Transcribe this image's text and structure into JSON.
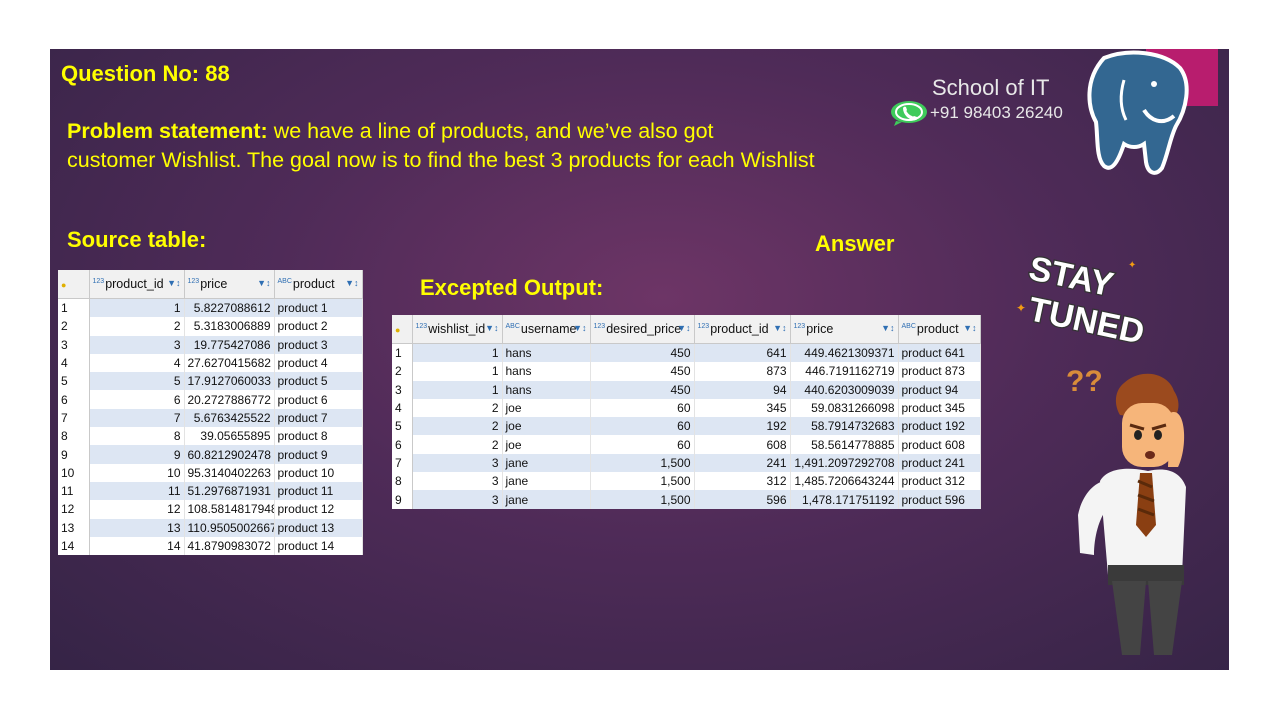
{
  "question": "Question No: 88",
  "problem": {
    "label": "Problem statement:",
    "line1": " we have a line of products, and we’ve also got",
    "line2": "customer Wishlist. The goal now is to find the best 3 products for each Wishlist"
  },
  "source_title": "Source table:",
  "answer_title": "Answer",
  "output_title": "Excepted Output:",
  "brand": {
    "name": "School of IT",
    "phone": "+91 98403 26240"
  },
  "colors": {
    "slide_bg": "#4f2b58",
    "heading": "#ffff00",
    "accent_bar": "#b81d6e",
    "row_alt": "#dde6f3"
  },
  "icons": [
    "whatsapp-icon",
    "postgresql-elephant-logo",
    "stay-tuned-sticker",
    "confused-man-illustration"
  ],
  "sticker_text": [
    "STAY",
    "TUNED"
  ],
  "sticker_marks": "??",
  "source_table": {
    "columns": [
      {
        "type": "123",
        "name": "product_id"
      },
      {
        "type": "123",
        "name": "price"
      },
      {
        "type": "ABC",
        "name": "product"
      }
    ],
    "rows": [
      [
        "1",
        "1",
        "5.8227088612",
        "product 1"
      ],
      [
        "2",
        "2",
        "5.3183006889",
        "product 2"
      ],
      [
        "3",
        "3",
        "19.775427086",
        "product 3"
      ],
      [
        "4",
        "4",
        "27.6270415682",
        "product 4"
      ],
      [
        "5",
        "5",
        "17.9127060033",
        "product 5"
      ],
      [
        "6",
        "6",
        "20.2727886772",
        "product 6"
      ],
      [
        "7",
        "7",
        "5.6763425522",
        "product 7"
      ],
      [
        "8",
        "8",
        "39.05655895",
        "product 8"
      ],
      [
        "9",
        "9",
        "60.8212902478",
        "product 9"
      ],
      [
        "10",
        "10",
        "95.3140402263",
        "product 10"
      ],
      [
        "11",
        "11",
        "51.2976871931",
        "product 11"
      ],
      [
        "12",
        "12",
        "108.5814817948",
        "product 12"
      ],
      [
        "13",
        "13",
        "110.9505002667",
        "product 13"
      ],
      [
        "14",
        "14",
        "41.8790983072",
        "product 14"
      ]
    ]
  },
  "output_table": {
    "columns": [
      {
        "type": "123",
        "name": "wishlist_id"
      },
      {
        "type": "ABC",
        "name": "username"
      },
      {
        "type": "123",
        "name": "desired_price"
      },
      {
        "type": "123",
        "name": "product_id"
      },
      {
        "type": "123",
        "name": "price"
      },
      {
        "type": "ABC",
        "name": "product"
      }
    ],
    "rows": [
      [
        "1",
        "1",
        "hans",
        "450",
        "641",
        "449.4621309371",
        "product 641"
      ],
      [
        "2",
        "1",
        "hans",
        "450",
        "873",
        "446.7191162719",
        "product 873"
      ],
      [
        "3",
        "1",
        "hans",
        "450",
        "94",
        "440.6203009039",
        "product 94"
      ],
      [
        "4",
        "2",
        "joe",
        "60",
        "345",
        "59.0831266098",
        "product 345"
      ],
      [
        "5",
        "2",
        "joe",
        "60",
        "192",
        "58.7914732683",
        "product 192"
      ],
      [
        "6",
        "2",
        "joe",
        "60",
        "608",
        "58.5614778885",
        "product 608"
      ],
      [
        "7",
        "3",
        "jane",
        "1,500",
        "241",
        "1,491.2097292708",
        "product 241"
      ],
      [
        "8",
        "3",
        "jane",
        "1,500",
        "312",
        "1,485.7206643244",
        "product 312"
      ],
      [
        "9",
        "3",
        "jane",
        "1,500",
        "596",
        "1,478.171751192",
        "product 596"
      ]
    ]
  }
}
